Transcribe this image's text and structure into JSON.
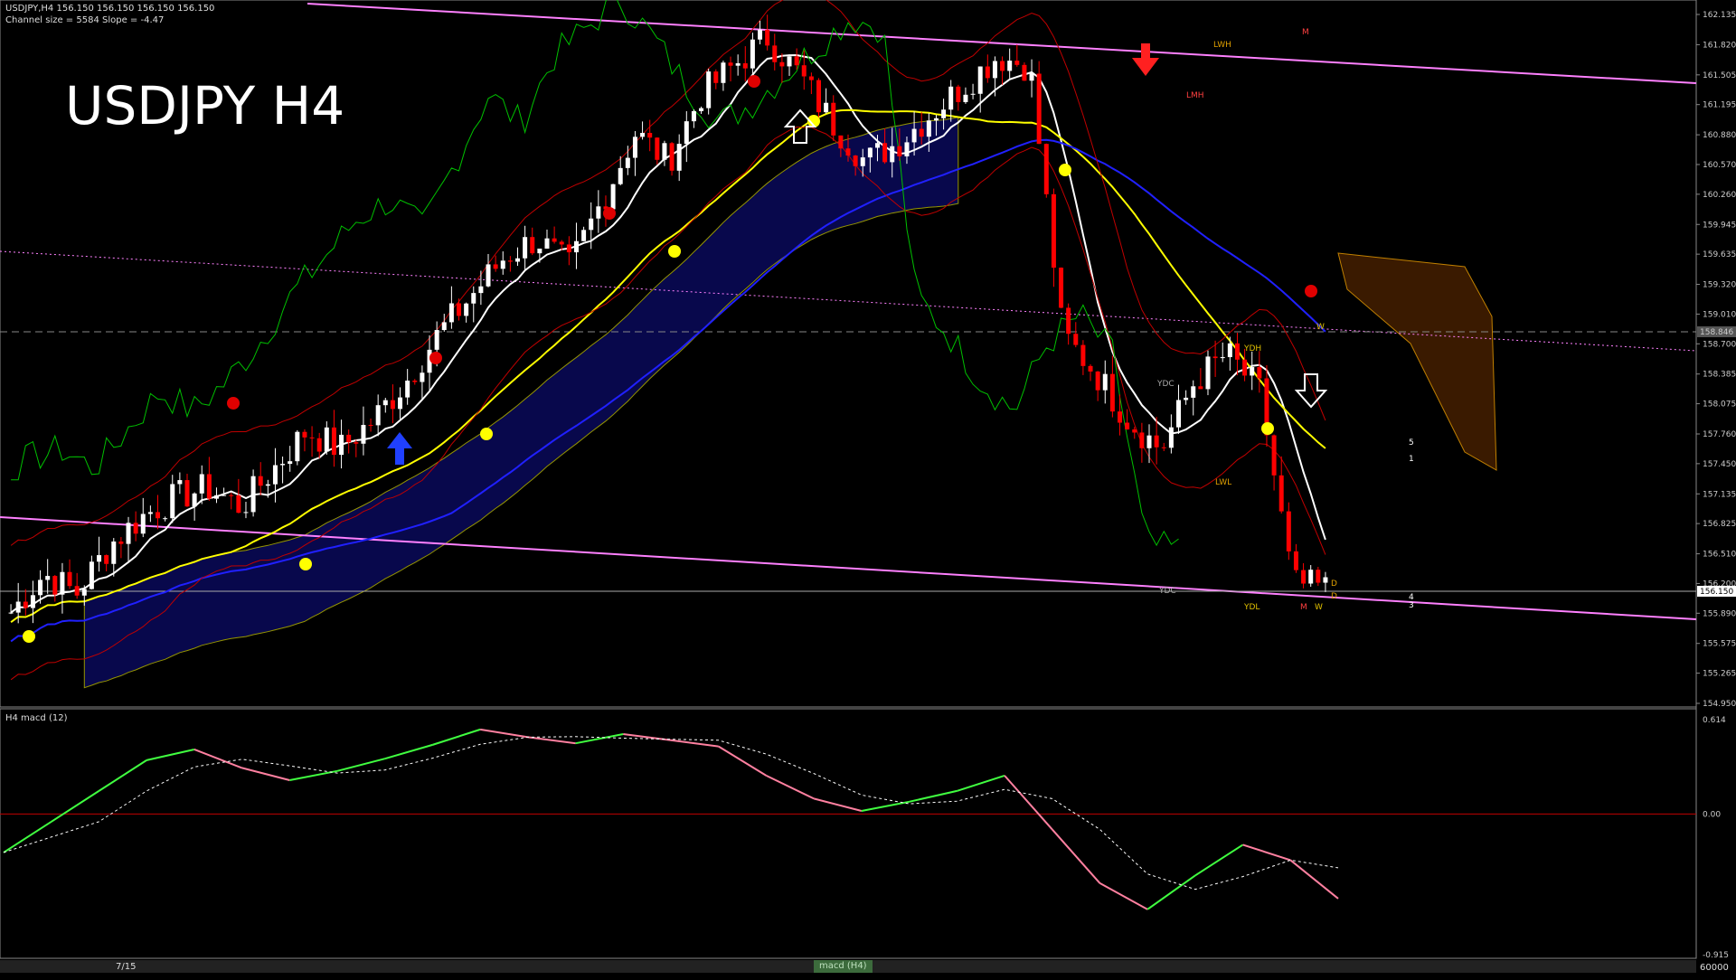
{
  "header": {
    "symbol_line": "USDJPY,H4  156.150 156.150 156.150 156.150",
    "channel_line": "Channel size = 5584 Slope = -4.47"
  },
  "title": "USDJPY H4",
  "price_axis": [
    "162.135",
    "161.820",
    "161.505",
    "161.195",
    "160.880",
    "160.570",
    "160.260",
    "159.945",
    "159.635",
    "159.320",
    "159.010",
    "158.700",
    "158.385",
    "158.075",
    "157.760",
    "157.450",
    "157.135",
    "156.825",
    "156.510",
    "156.200",
    "155.890",
    "155.575",
    "155.265",
    "154.950"
  ],
  "current_price": "156.150",
  "ref_price": "158.846",
  "level_labels": {
    "lwh": "LWH",
    "lmh": "LMH",
    "m_top": "M",
    "ydh": "YDH",
    "ydc_top": "YDC",
    "ydl": "YDL",
    "lwl": "LWL",
    "ydc_bot": "YDC",
    "w_top": "W",
    "m_bot": "M",
    "w_bot": "W",
    "d1": "D",
    "d2": "D"
  },
  "wave_labels": [
    "5",
    "1",
    "4",
    "3"
  ],
  "macd": {
    "label": "H4  macd (12)",
    "axis": [
      "0.614",
      "0.00",
      "-0.915"
    ]
  },
  "bottom_bar": {
    "date_tick": "7/15",
    "tab_label": "macd (H4)",
    "right_value": "60000"
  },
  "colors": {
    "bull": "#ffffff",
    "bear": "#ff0000",
    "ma_white": "#ffffff",
    "ma_yellow": "#ffff00",
    "ma_blue": "#2020ff",
    "ichimoku_green": "#00c000",
    "channel": "#ff80ff",
    "macd_up": "#40ff40",
    "macd_down": "#ff80a0"
  },
  "chart_data": {
    "type": "candlestick",
    "title": "USDJPY H4",
    "ylim": [
      154.95,
      162.135
    ],
    "candles_description": "H4 candles: rally from ~156.2 to ~162.0, then sharp drop to ~156.15",
    "close_path": [
      155.9,
      156.3,
      156.1,
      156.6,
      156.9,
      157.1,
      157.2,
      157.0,
      157.4,
      157.8,
      157.6,
      157.9,
      158.3,
      158.8,
      159.2,
      159.6,
      159.8,
      159.5,
      160.2,
      160.9,
      160.6,
      161.3,
      161.6,
      161.9,
      161.5,
      161.0,
      160.6,
      160.8,
      161.1,
      161.4,
      161.7,
      161.6,
      158.8,
      158.4,
      157.9,
      157.6,
      158.3,
      158.6,
      158.2,
      156.2,
      156.15
    ],
    "macd_path": [
      -0.25,
      -0.05,
      0.15,
      0.35,
      0.42,
      0.3,
      0.22,
      0.28,
      0.36,
      0.45,
      0.55,
      0.5,
      0.46,
      0.52,
      0.48,
      0.44,
      0.25,
      0.1,
      0.02,
      0.08,
      0.15,
      0.25,
      -0.1,
      -0.45,
      -0.62,
      -0.4,
      -0.2,
      -0.3,
      -0.55
    ]
  }
}
